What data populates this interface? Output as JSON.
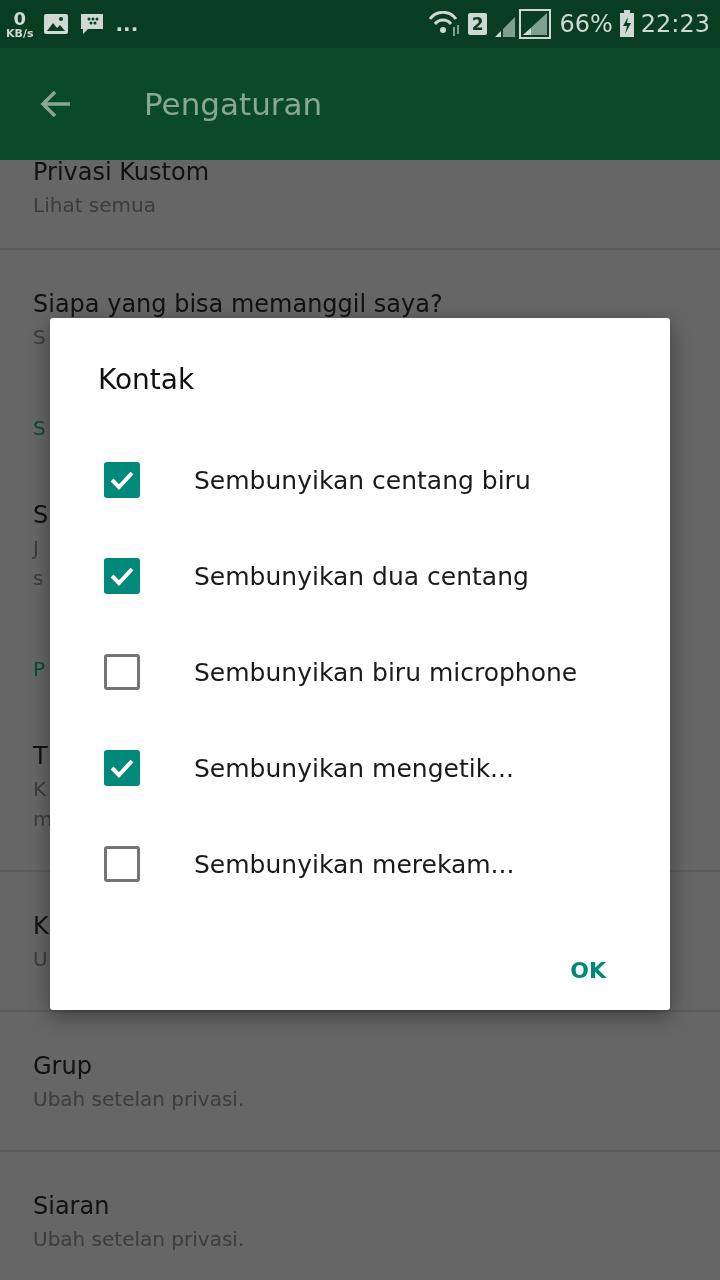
{
  "status_bar": {
    "speed": "0",
    "speed_unit": "KB/s",
    "more": "...",
    "sim": "2",
    "battery": "66%",
    "time": "22:23"
  },
  "app_bar": {
    "title": "Pengaturan"
  },
  "groups": [
    {
      "items": [
        {
          "kind": "row",
          "title": "Privasi Kustom",
          "subtitle": [
            "Lihat semua"
          ]
        }
      ]
    },
    {
      "items": [
        {
          "kind": "row",
          "title": "Siapa yang bisa memanggil saya?",
          "subtitle": [
            "S"
          ]
        },
        {
          "kind": "header",
          "title": "S"
        },
        {
          "kind": "row",
          "title": "S",
          "subtitle": [
            "J",
            "s"
          ]
        },
        {
          "kind": "header",
          "title": "P"
        },
        {
          "kind": "row",
          "title": "T",
          "subtitle": [
            "K",
            "m"
          ]
        }
      ]
    },
    {
      "items": [
        {
          "kind": "row",
          "title": "K",
          "subtitle": [
            "U"
          ]
        }
      ]
    },
    {
      "items": [
        {
          "kind": "row",
          "title": "Grup",
          "subtitle": [
            "Ubah setelan privasi."
          ]
        }
      ]
    },
    {
      "items": [
        {
          "kind": "row",
          "title": "Siaran",
          "subtitle": [
            "Ubah setelan privasi."
          ]
        }
      ]
    }
  ],
  "dialog": {
    "title": "Kontak",
    "options": [
      {
        "label": "Sembunyikan centang biru",
        "checked": true
      },
      {
        "label": "Sembunyikan dua centang",
        "checked": true
      },
      {
        "label": "Sembunyikan biru microphone",
        "checked": false
      },
      {
        "label": "Sembunyikan mengetik...",
        "checked": true
      },
      {
        "label": "Sembunyikan merekam...",
        "checked": false
      }
    ],
    "button": "OK"
  }
}
